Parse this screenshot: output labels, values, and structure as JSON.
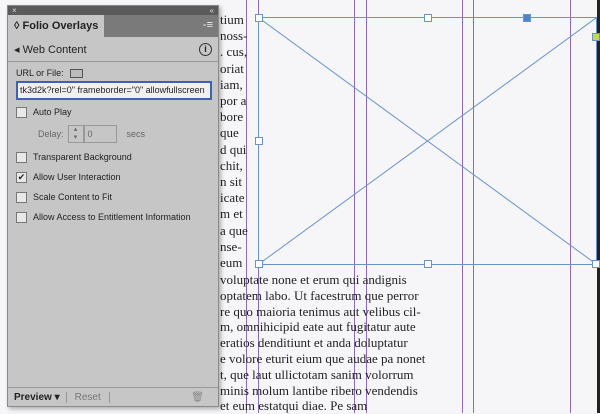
{
  "document": {
    "top_lines": [
      "tium",
      "noss-",
      ". cus,",
      "oriat",
      "iam,",
      "por a",
      "bore",
      "que",
      "d qui",
      "chit,",
      "n sit",
      "icate",
      "m et",
      "a que",
      "nse-",
      "eum"
    ],
    "bottom_lines": [
      "voluptate none et erum qui andignis",
      "optatem labo. Ut facestrum que perror",
      "re quo maioria tenimus aut velibus cil-",
      "m, omnihicipid eate aut fugitatur aute",
      "eratios denditiunt et anda doluptatur",
      "e volore eturit eium que audae pa nonet",
      "t, que laut ullictotam sanim volorrum",
      "minis molum lantibe ribero vendendis",
      "et eum estatqui diae. Pe sam"
    ]
  },
  "panel": {
    "title": "Folio Overlays",
    "section": "Web Content",
    "url_label": "URL or File:",
    "url_value": "tk3d2k?rel=0\" frameborder=\"0\" allowfullscreen",
    "auto_play": "Auto Play",
    "delay_label": "Delay:",
    "delay_value": "0",
    "delay_unit": "secs",
    "options": [
      {
        "label": "Transparent Background",
        "checked": false
      },
      {
        "label": "Allow User Interaction",
        "checked": true
      },
      {
        "label": "Scale Content to Fit",
        "checked": false
      },
      {
        "label": "Allow Access to Entitlement Information",
        "checked": false
      }
    ],
    "preview": "Preview",
    "reset": "Reset"
  }
}
